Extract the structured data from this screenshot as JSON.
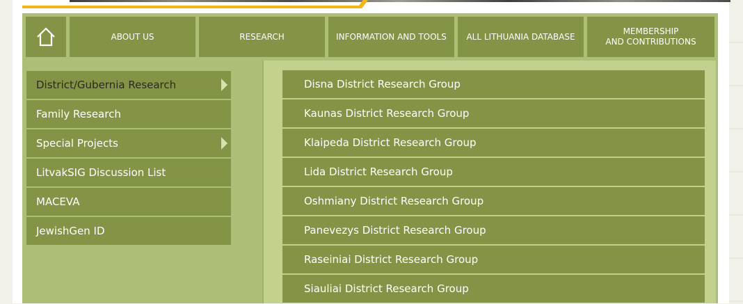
{
  "nav": {
    "home_icon": "home-icon",
    "items": [
      {
        "label": "ABOUT US"
      },
      {
        "label": "RESEARCH"
      },
      {
        "label": "INFORMATION AND TOOLS"
      },
      {
        "label": "ALL LITHUANIA DATABASE"
      },
      {
        "label": "MEMBERSHIP\nAND CONTRIBUTIONS"
      }
    ]
  },
  "sidebar": {
    "items": [
      {
        "label": "District/Gubernia Research",
        "has_submenu": true,
        "active": true
      },
      {
        "label": "Family Research"
      },
      {
        "label": "Special Projects",
        "has_submenu": true
      },
      {
        "label": "LitvakSIG Discussion List"
      },
      {
        "label": "MACEVA"
      },
      {
        "label": "JewishGen ID"
      }
    ]
  },
  "submenu": {
    "items": [
      {
        "label": "Disna District Research Group"
      },
      {
        "label": "Kaunas District Research Group"
      },
      {
        "label": "Klaipeda District Research Group"
      },
      {
        "label": "Lida District Research Group"
      },
      {
        "label": "Oshmiany District Research Group"
      },
      {
        "label": "Panevezys District Research Group"
      },
      {
        "label": "Raseiniai District Research Group"
      },
      {
        "label": "Siauliai District Research Group"
      }
    ]
  },
  "colors": {
    "nav_bg": "#839446",
    "frame_bg": "#adbf77",
    "panel_bg": "#c2d18e",
    "accent": "#f2b619"
  }
}
